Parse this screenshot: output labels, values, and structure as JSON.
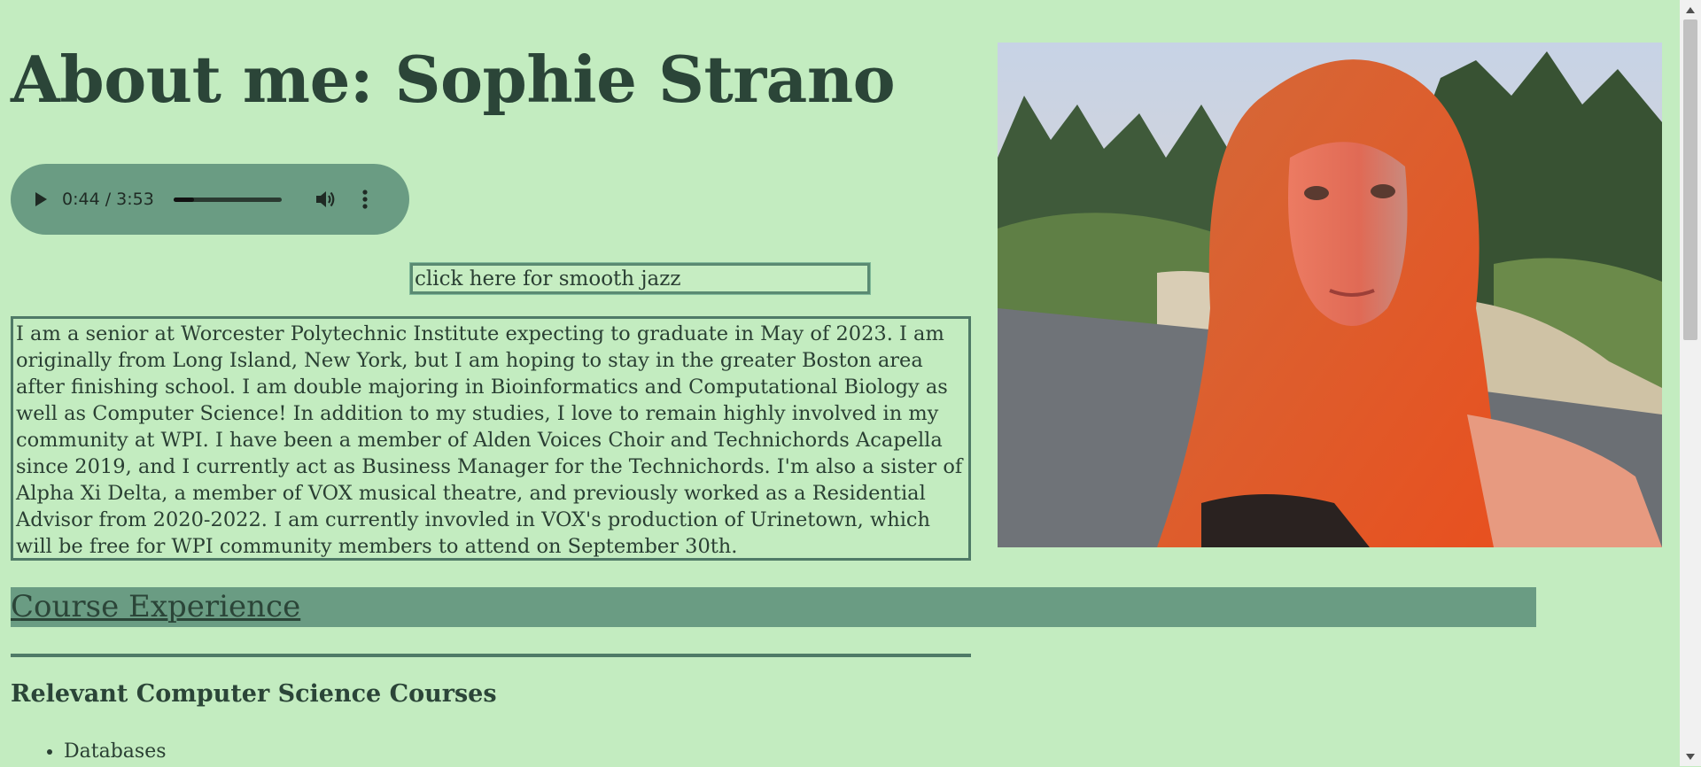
{
  "header": {
    "title": "About me: Sophie Strano"
  },
  "audio": {
    "time_display": "0:44 / 3:53",
    "progress": 0.19,
    "icons": [
      "play-icon",
      "volume-icon",
      "more-vert-icon"
    ]
  },
  "jazz_button": {
    "label": "click here for smooth jazz"
  },
  "bio": {
    "text": "I am a senior at Worcester Polytechnic Institute expecting to graduate in May of 2023. I am originally from Long Island, New York, but I am hoping to stay in the greater Boston area after finishing school. I am double majoring in Bioinformatics and Computational Biology as well as Computer Science! In addition to my studies, I love to remain highly involved in my community at WPI. I have been a member of Alden Voices Choir and Technichords Acapella since 2019, and I currently act as Business Manager for the Technichords. I'm also a sister of Alpha Xi Delta, a member of VOX musical theatre, and previously worked as a Residential Advisor from 2020-2022. I am currently invovled in VOX's production of Urinetown, which will be free for WPI community members to attend on September 30th."
  },
  "course_section": {
    "heading": "Course Experience",
    "subheading": "Relevant Computer Science Courses",
    "courses": [
      "Databases"
    ]
  },
  "colors": {
    "background": "#c3ecc0",
    "accent": "#6a9c83",
    "text": "#2a3f33"
  }
}
